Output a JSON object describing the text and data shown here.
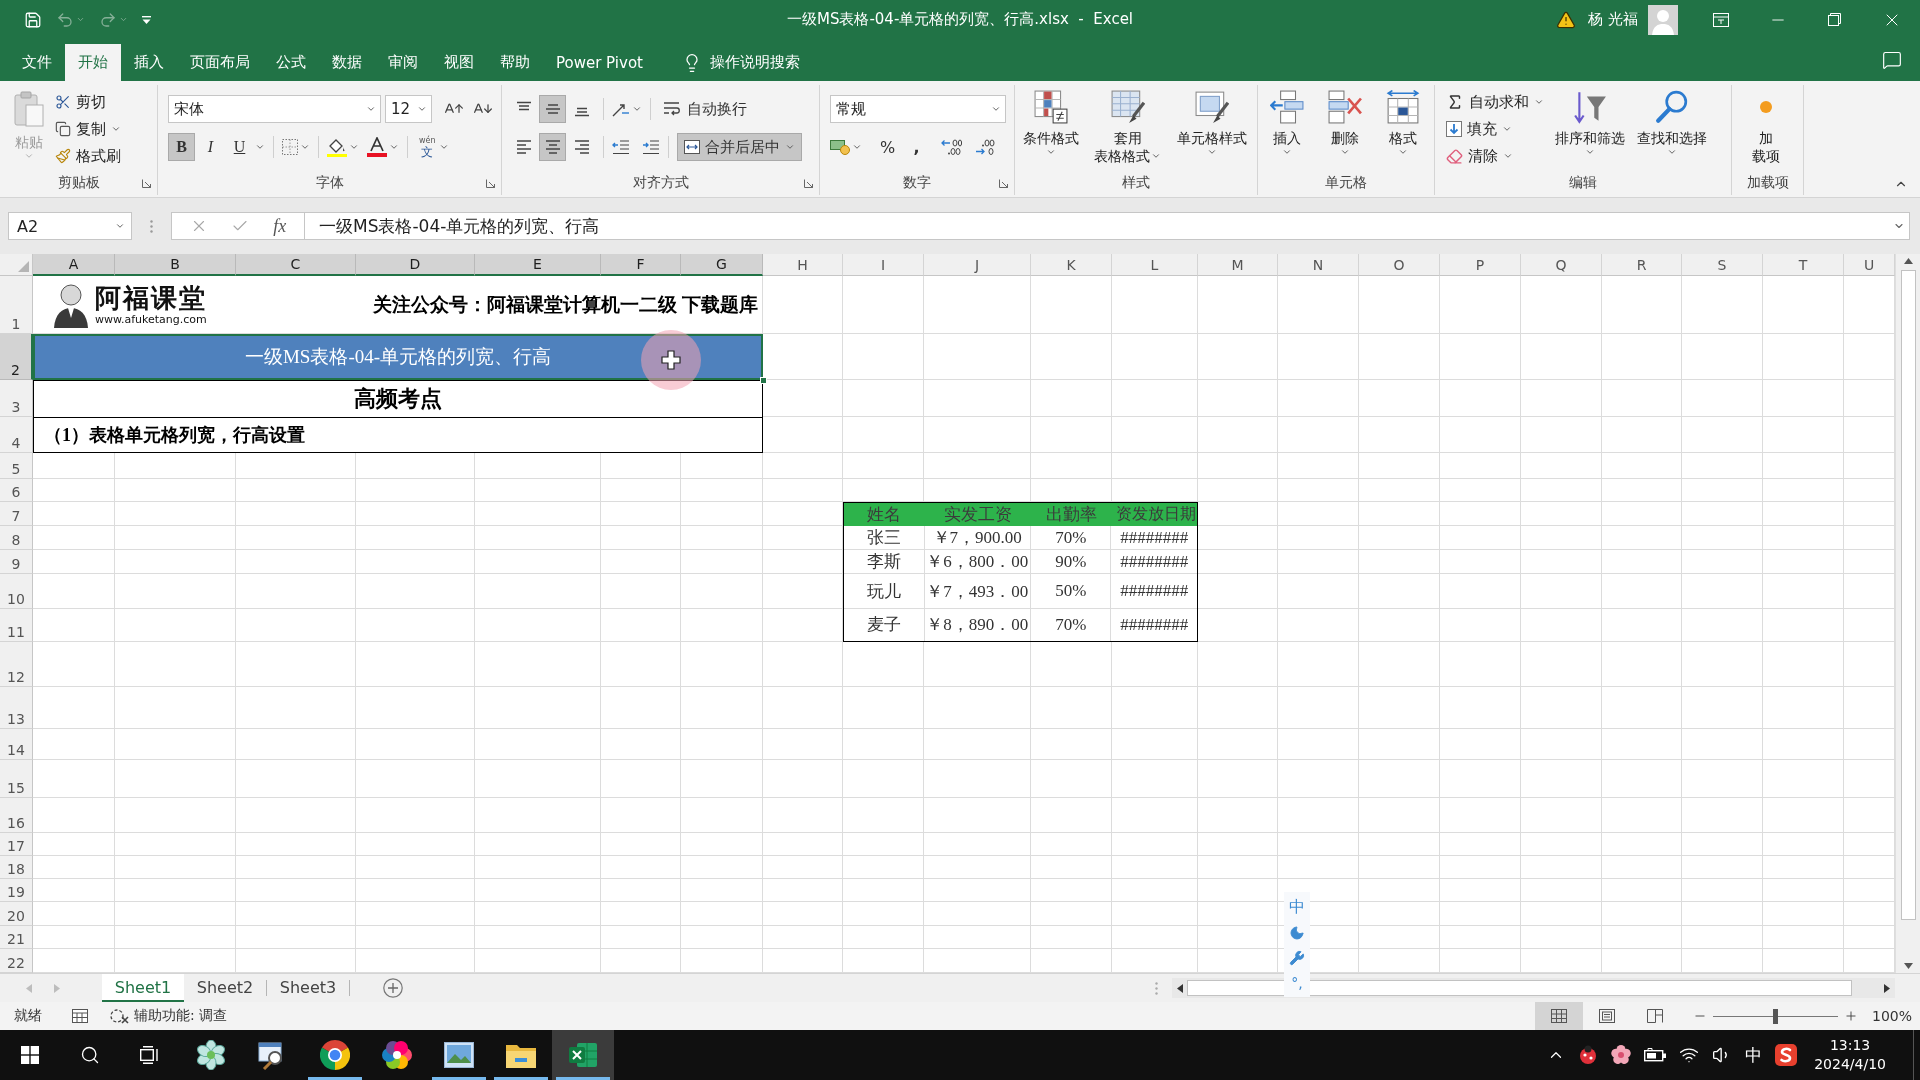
{
  "title_bar": {
    "quick_access": [
      {
        "kind": "save",
        "disabled": false
      },
      {
        "kind": "undo",
        "disabled": true
      },
      {
        "kind": "redo",
        "disabled": true
      },
      {
        "kind": "customize",
        "disabled": false
      }
    ],
    "title": "一级MS表格-04-单元格的列宽、行高.xlsx  -  Excel",
    "user": "杨 光福"
  },
  "menu_tabs": [
    {
      "label": "文件",
      "selected": false
    },
    {
      "label": "开始",
      "selected": true
    },
    {
      "label": "插入",
      "selected": false
    },
    {
      "label": "页面布局",
      "selected": false
    },
    {
      "label": "公式",
      "selected": false
    },
    {
      "label": "数据",
      "selected": false
    },
    {
      "label": "审阅",
      "selected": false
    },
    {
      "label": "视图",
      "selected": false
    },
    {
      "label": "帮助",
      "selected": false
    },
    {
      "label": "Power Pivot",
      "selected": false
    }
  ],
  "tell_me": "操作说明搜索",
  "ribbon": {
    "clipboard": {
      "label": "剪贴板",
      "paste": {
        "label": "粘贴",
        "disabled": true
      },
      "cut": "剪切",
      "copy": "复制",
      "format_painter": "格式刷"
    },
    "font": {
      "label": "字体",
      "font_name": "宋体",
      "font_size": "12",
      "bold": {
        "label": "B",
        "selected": true
      },
      "italic": {
        "label": "I",
        "selected": false
      },
      "underline": {
        "label": "U",
        "selected": false
      },
      "phonetic": [
        "wén",
        "文"
      ]
    },
    "alignment": {
      "label": "对齐方式",
      "vertical": [
        {
          "kind": "top",
          "selected": false
        },
        {
          "kind": "middle",
          "selected": true
        },
        {
          "kind": "bottom",
          "selected": false
        }
      ],
      "horizontal": [
        {
          "kind": "left",
          "selected": false
        },
        {
          "kind": "center",
          "selected": true
        },
        {
          "kind": "right",
          "selected": false
        }
      ],
      "wrap_text": {
        "label": "自动换行",
        "selected": false
      },
      "merge_center": {
        "label": "合并后居中",
        "selected": true
      }
    },
    "number": {
      "label": "数字",
      "format": "常规",
      "percent": "%",
      "comma": ","
    },
    "styles": {
      "label": "样式",
      "buttons": [
        {
          "kind": "conditional",
          "lines": [
            "条件格式"
          ]
        },
        {
          "kind": "table",
          "lines": [
            "套用",
            "表格格式"
          ]
        },
        {
          "kind": "cell",
          "lines": [
            "单元格样式"
          ]
        }
      ]
    },
    "cells": {
      "label": "单元格",
      "buttons": [
        {
          "kind": "insert",
          "lines": [
            "插入"
          ]
        },
        {
          "kind": "delete",
          "lines": [
            "删除"
          ]
        },
        {
          "kind": "format",
          "lines": [
            "格式"
          ]
        }
      ]
    },
    "editing": {
      "label": "编辑",
      "small": [
        {
          "kind": "sum",
          "label": "自动求和"
        },
        {
          "kind": "fill",
          "label": "填充"
        },
        {
          "kind": "clear",
          "label": "清除"
        }
      ],
      "buttons": [
        {
          "kind": "sort",
          "lines": [
            "排序和筛选"
          ]
        },
        {
          "kind": "find",
          "lines": [
            "查找和选择"
          ]
        }
      ]
    },
    "addins": {
      "label": "加载项",
      "buttons": [
        {
          "kind": "addin",
          "lines": [
            "加",
            "载项"
          ]
        }
      ]
    }
  },
  "formula_bar": {
    "name_box": "A2",
    "function_button": "fx",
    "formula": "一级MS表格-04-单元格的列宽、行高"
  },
  "sheet": {
    "columns": [
      {
        "label": "A",
        "selected": true
      },
      {
        "label": "B",
        "selected": true
      },
      {
        "label": "C",
        "selected": true
      },
      {
        "label": "D",
        "selected": true
      },
      {
        "label": "E",
        "selected": true
      },
      {
        "label": "F",
        "selected": true
      },
      {
        "label": "G",
        "selected": true
      },
      {
        "label": "H",
        "selected": false
      },
      {
        "label": "I",
        "selected": false
      },
      {
        "label": "J",
        "selected": false
      },
      {
        "label": "K",
        "selected": false
      },
      {
        "label": "L",
        "selected": false
      },
      {
        "label": "M",
        "selected": false
      },
      {
        "label": "N",
        "selected": false
      },
      {
        "label": "O",
        "selected": false
      },
      {
        "label": "P",
        "selected": false
      },
      {
        "label": "Q",
        "selected": false
      },
      {
        "label": "R",
        "selected": false
      },
      {
        "label": "S",
        "selected": false
      },
      {
        "label": "T",
        "selected": false
      },
      {
        "label": "U",
        "selected": false
      }
    ],
    "rows": [
      {
        "label": "1",
        "selected": false
      },
      {
        "label": "2",
        "selected": true
      },
      {
        "label": "3",
        "selected": false
      },
      {
        "label": "4",
        "selected": false
      },
      {
        "label": "5",
        "selected": false
      },
      {
        "label": "6",
        "selected": false
      },
      {
        "label": "7",
        "selected": false
      },
      {
        "label": "8",
        "selected": false
      },
      {
        "label": "9",
        "selected": false
      },
      {
        "label": "10",
        "selected": false
      },
      {
        "label": "11",
        "selected": false
      },
      {
        "label": "12",
        "selected": false
      },
      {
        "label": "13",
        "selected": false
      },
      {
        "label": "14",
        "selected": false
      },
      {
        "label": "15",
        "selected": false
      },
      {
        "label": "16",
        "selected": false
      },
      {
        "label": "17",
        "selected": false
      },
      {
        "label": "18",
        "selected": false
      },
      {
        "label": "19",
        "selected": false
      },
      {
        "label": "20",
        "selected": false
      },
      {
        "label": "21",
        "selected": false
      },
      {
        "label": "22",
        "selected": false
      }
    ],
    "merged_rows": [
      {
        "kind": "banner",
        "logo_title": "阿福课堂",
        "logo_url": "www.afuketang.com",
        "text": "关注公众号：阿福课堂计算机一二级 下载题库",
        "selected": false
      },
      {
        "kind": "title",
        "text": "一级MS表格-04-单元格的列宽、行高",
        "selected": true
      },
      {
        "kind": "heading",
        "text": "高频考点",
        "selected": false
      },
      {
        "kind": "item",
        "text": "（1）表格单元格列宽，行高设置",
        "selected": false
      }
    ],
    "table": {
      "columns": [
        "姓名",
        "实发工资",
        "出勤率",
        "资发放日期"
      ],
      "rows": [
        [
          "张三",
          "￥7，900.00",
          "70%",
          "########"
        ],
        [
          "李斯",
          "￥6，800．00",
          "90%",
          "########"
        ],
        [
          "玩儿",
          "￥7，493．00",
          "50%",
          "########"
        ],
        [
          "麦子",
          "￥8，890．00",
          "70%",
          "########"
        ]
      ]
    }
  },
  "ime_bar": {
    "mode": "中",
    "punctuation": "°,"
  },
  "sheet_tabs": [
    {
      "label": "Sheet1",
      "selected": true
    },
    {
      "label": "Sheet2",
      "selected": false
    },
    {
      "label": "Sheet3",
      "selected": false
    }
  ],
  "status_bar": {
    "ready": "就绪",
    "accessibility": "辅助功能: 调查",
    "views": [
      {
        "kind": "normal",
        "selected": true
      },
      {
        "kind": "page_layout",
        "selected": false
      },
      {
        "kind": "page_break",
        "selected": false
      }
    ],
    "zoom": {
      "level": 0.5,
      "label": "100%"
    }
  },
  "taskbar": {
    "apps": [
      {
        "kind": "flower",
        "running": false,
        "selected": false
      },
      {
        "kind": "magnifier",
        "running": false,
        "selected": false
      },
      {
        "kind": "browser",
        "running": true,
        "selected": false
      },
      {
        "kind": "color_ring",
        "running": false,
        "selected": false
      },
      {
        "kind": "picture",
        "running": true,
        "selected": false
      },
      {
        "kind": "folder",
        "running": true,
        "selected": false
      },
      {
        "kind": "spreadsheet",
        "running": true,
        "selected": true
      }
    ],
    "ime": "中",
    "time": "13:13",
    "date": "2024/4/10"
  }
}
